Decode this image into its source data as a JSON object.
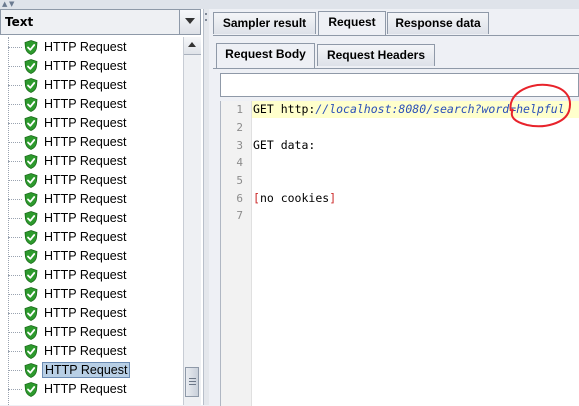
{
  "tree_panel": {
    "combo_value": "Text",
    "items": [
      {
        "label": "HTTP Request"
      },
      {
        "label": "HTTP Request"
      },
      {
        "label": "HTTP Request"
      },
      {
        "label": "HTTP Request"
      },
      {
        "label": "HTTP Request"
      },
      {
        "label": "HTTP Request"
      },
      {
        "label": "HTTP Request"
      },
      {
        "label": "HTTP Request"
      },
      {
        "label": "HTTP Request"
      },
      {
        "label": "HTTP Request"
      },
      {
        "label": "HTTP Request"
      },
      {
        "label": "HTTP Request"
      },
      {
        "label": "HTTP Request"
      },
      {
        "label": "HTTP Request"
      },
      {
        "label": "HTTP Request"
      },
      {
        "label": "HTTP Request"
      },
      {
        "label": "HTTP Request"
      },
      {
        "label": "HTTP Request"
      },
      {
        "label": "HTTP Request"
      }
    ],
    "selected_index": 17,
    "item_icon": "green-shield-check-icon"
  },
  "result_tabs": {
    "tabs": [
      "Sampler result",
      "Request",
      "Response data"
    ],
    "active": "Request"
  },
  "request_tabs": {
    "tabs": [
      "Request Body",
      "Request Headers"
    ],
    "active": "Request Body"
  },
  "search_field": {
    "value": ""
  },
  "editor": {
    "line_numbers": [
      "1",
      "2",
      "3",
      "4",
      "5",
      "6",
      "7"
    ],
    "line1": {
      "method": "GET",
      "scheme": "http:",
      "rest": "//localhost:8080/search?word=helpful"
    },
    "line3": "GET data:",
    "line6": {
      "open": "[",
      "text": "no cookies",
      "close": "]"
    }
  },
  "colors": {
    "annotation": "#e8232b",
    "current_line": "#ffffcc",
    "selection": "#b8cfe5"
  }
}
